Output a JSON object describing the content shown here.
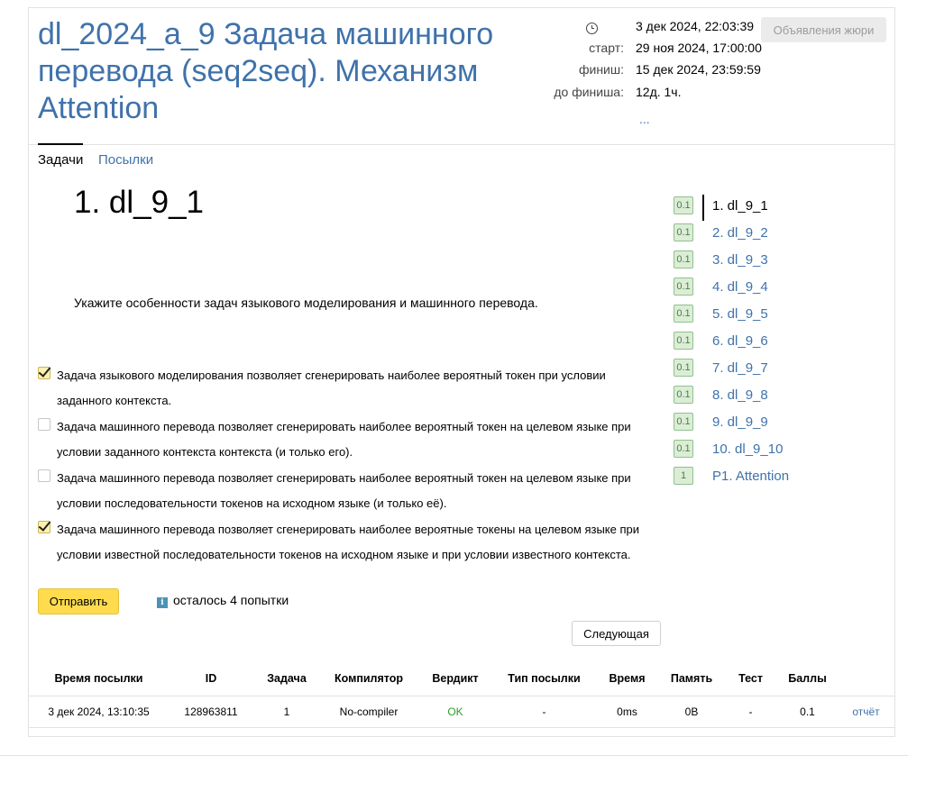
{
  "contest": {
    "title": "dl_2024_a_9 Задача машинного перевода (seq2seq). Механизм Attention",
    "now_time": "3 дек 2024, 22:03:39",
    "start_label": "старт:",
    "start_time": "29 ноя 2024, 17:00:00",
    "finish_label": "финиш:",
    "finish_time": "15 дек 2024, 23:59:59",
    "remaining_label": "до финиша:",
    "remaining": "12д. 1ч.",
    "more": "...",
    "jury_button": "Объявления жюри"
  },
  "tabs": {
    "problems": "Задачи",
    "submissions": "Посылки"
  },
  "problem": {
    "title": "1. dl_9_1",
    "statement": "Укажите особенности задач языкового моделирования и машинного перевода.",
    "options": [
      {
        "text": "Задача языкового моделирования позволяет сгенерировать наиболее вероятный токен при условии заданного контекста.",
        "checked": true
      },
      {
        "text": "Задача машинного перевода позволяет сгенерировать наиболее вероятный токен на целевом языке при условии заданного контекста контекста (и только его).",
        "checked": false
      },
      {
        "text": "Задача машинного перевода позволяет сгенерировать наиболее вероятный токен на целевом языке при условии последовательности токенов на исходном языке (и только её).",
        "checked": false
      },
      {
        "text": "Задача машинного перевода позволяет сгенерировать наиболее вероятные токены на целевом языке при условии известной последовательности токенов на исходном языке и при условии известного контекста.",
        "checked": true
      }
    ],
    "submit_label": "Отправить",
    "info_icon_glyph": "i",
    "attempts_left": "осталось 4 попытки",
    "next_label": "Следующая"
  },
  "problem_list": [
    {
      "score": "0.1",
      "name": "1. dl_9_1",
      "current": true
    },
    {
      "score": "0.1",
      "name": "2. dl_9_2"
    },
    {
      "score": "0.1",
      "name": "3. dl_9_3"
    },
    {
      "score": "0.1",
      "name": "4. dl_9_4"
    },
    {
      "score": "0.1",
      "name": "5. dl_9_5"
    },
    {
      "score": "0.1",
      "name": "6. dl_9_6"
    },
    {
      "score": "0.1",
      "name": "7. dl_9_7"
    },
    {
      "score": "0.1",
      "name": "8. dl_9_8"
    },
    {
      "score": "0.1",
      "name": "9. dl_9_9"
    },
    {
      "score": "0.1",
      "name": "10. dl_9_10"
    },
    {
      "score": "1",
      "name": "P1. Attention"
    }
  ],
  "submissions": {
    "headers": [
      "Время посылки",
      "ID",
      "Задача",
      "Компилятор",
      "Вердикт",
      "Тип посылки",
      "Время",
      "Память",
      "Тест",
      "Баллы",
      ""
    ],
    "rows": [
      {
        "time": "3 дек 2024, 13:10:35",
        "id": "128963811",
        "problem": "1",
        "compiler": "No-compiler",
        "verdict": "OK",
        "type": "-",
        "runtime": "0ms",
        "memory": "0B",
        "test": "-",
        "score": "0.1",
        "report": "отчёт"
      }
    ]
  },
  "colors": {
    "link": "#3f72ab",
    "submit_button": "#ffdb4d",
    "verdict_ok": "#2a9d2a",
    "score_badge": "#dcedd5"
  }
}
